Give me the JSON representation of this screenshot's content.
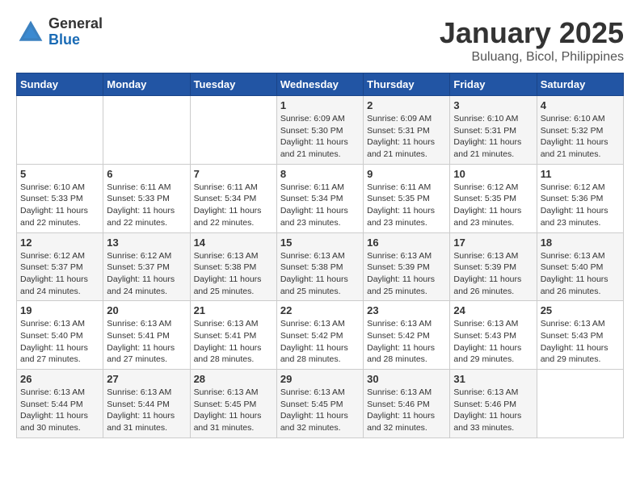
{
  "header": {
    "logo": {
      "line1": "General",
      "line2": "Blue"
    },
    "title": "January 2025",
    "location": "Buluang, Bicol, Philippines"
  },
  "days_of_week": [
    "Sunday",
    "Monday",
    "Tuesday",
    "Wednesday",
    "Thursday",
    "Friday",
    "Saturday"
  ],
  "weeks": [
    [
      {
        "day": "",
        "info": ""
      },
      {
        "day": "",
        "info": ""
      },
      {
        "day": "",
        "info": ""
      },
      {
        "day": "1",
        "info": "Sunrise: 6:09 AM\nSunset: 5:30 PM\nDaylight: 11 hours and 21 minutes."
      },
      {
        "day": "2",
        "info": "Sunrise: 6:09 AM\nSunset: 5:31 PM\nDaylight: 11 hours and 21 minutes."
      },
      {
        "day": "3",
        "info": "Sunrise: 6:10 AM\nSunset: 5:31 PM\nDaylight: 11 hours and 21 minutes."
      },
      {
        "day": "4",
        "info": "Sunrise: 6:10 AM\nSunset: 5:32 PM\nDaylight: 11 hours and 21 minutes."
      }
    ],
    [
      {
        "day": "5",
        "info": "Sunrise: 6:10 AM\nSunset: 5:33 PM\nDaylight: 11 hours and 22 minutes."
      },
      {
        "day": "6",
        "info": "Sunrise: 6:11 AM\nSunset: 5:33 PM\nDaylight: 11 hours and 22 minutes."
      },
      {
        "day": "7",
        "info": "Sunrise: 6:11 AM\nSunset: 5:34 PM\nDaylight: 11 hours and 22 minutes."
      },
      {
        "day": "8",
        "info": "Sunrise: 6:11 AM\nSunset: 5:34 PM\nDaylight: 11 hours and 23 minutes."
      },
      {
        "day": "9",
        "info": "Sunrise: 6:11 AM\nSunset: 5:35 PM\nDaylight: 11 hours and 23 minutes."
      },
      {
        "day": "10",
        "info": "Sunrise: 6:12 AM\nSunset: 5:35 PM\nDaylight: 11 hours and 23 minutes."
      },
      {
        "day": "11",
        "info": "Sunrise: 6:12 AM\nSunset: 5:36 PM\nDaylight: 11 hours and 23 minutes."
      }
    ],
    [
      {
        "day": "12",
        "info": "Sunrise: 6:12 AM\nSunset: 5:37 PM\nDaylight: 11 hours and 24 minutes."
      },
      {
        "day": "13",
        "info": "Sunrise: 6:12 AM\nSunset: 5:37 PM\nDaylight: 11 hours and 24 minutes."
      },
      {
        "day": "14",
        "info": "Sunrise: 6:13 AM\nSunset: 5:38 PM\nDaylight: 11 hours and 25 minutes."
      },
      {
        "day": "15",
        "info": "Sunrise: 6:13 AM\nSunset: 5:38 PM\nDaylight: 11 hours and 25 minutes."
      },
      {
        "day": "16",
        "info": "Sunrise: 6:13 AM\nSunset: 5:39 PM\nDaylight: 11 hours and 25 minutes."
      },
      {
        "day": "17",
        "info": "Sunrise: 6:13 AM\nSunset: 5:39 PM\nDaylight: 11 hours and 26 minutes."
      },
      {
        "day": "18",
        "info": "Sunrise: 6:13 AM\nSunset: 5:40 PM\nDaylight: 11 hours and 26 minutes."
      }
    ],
    [
      {
        "day": "19",
        "info": "Sunrise: 6:13 AM\nSunset: 5:40 PM\nDaylight: 11 hours and 27 minutes."
      },
      {
        "day": "20",
        "info": "Sunrise: 6:13 AM\nSunset: 5:41 PM\nDaylight: 11 hours and 27 minutes."
      },
      {
        "day": "21",
        "info": "Sunrise: 6:13 AM\nSunset: 5:41 PM\nDaylight: 11 hours and 28 minutes."
      },
      {
        "day": "22",
        "info": "Sunrise: 6:13 AM\nSunset: 5:42 PM\nDaylight: 11 hours and 28 minutes."
      },
      {
        "day": "23",
        "info": "Sunrise: 6:13 AM\nSunset: 5:42 PM\nDaylight: 11 hours and 28 minutes."
      },
      {
        "day": "24",
        "info": "Sunrise: 6:13 AM\nSunset: 5:43 PM\nDaylight: 11 hours and 29 minutes."
      },
      {
        "day": "25",
        "info": "Sunrise: 6:13 AM\nSunset: 5:43 PM\nDaylight: 11 hours and 29 minutes."
      }
    ],
    [
      {
        "day": "26",
        "info": "Sunrise: 6:13 AM\nSunset: 5:44 PM\nDaylight: 11 hours and 30 minutes."
      },
      {
        "day": "27",
        "info": "Sunrise: 6:13 AM\nSunset: 5:44 PM\nDaylight: 11 hours and 31 minutes."
      },
      {
        "day": "28",
        "info": "Sunrise: 6:13 AM\nSunset: 5:45 PM\nDaylight: 11 hours and 31 minutes."
      },
      {
        "day": "29",
        "info": "Sunrise: 6:13 AM\nSunset: 5:45 PM\nDaylight: 11 hours and 32 minutes."
      },
      {
        "day": "30",
        "info": "Sunrise: 6:13 AM\nSunset: 5:46 PM\nDaylight: 11 hours and 32 minutes."
      },
      {
        "day": "31",
        "info": "Sunrise: 6:13 AM\nSunset: 5:46 PM\nDaylight: 11 hours and 33 minutes."
      },
      {
        "day": "",
        "info": ""
      }
    ]
  ]
}
